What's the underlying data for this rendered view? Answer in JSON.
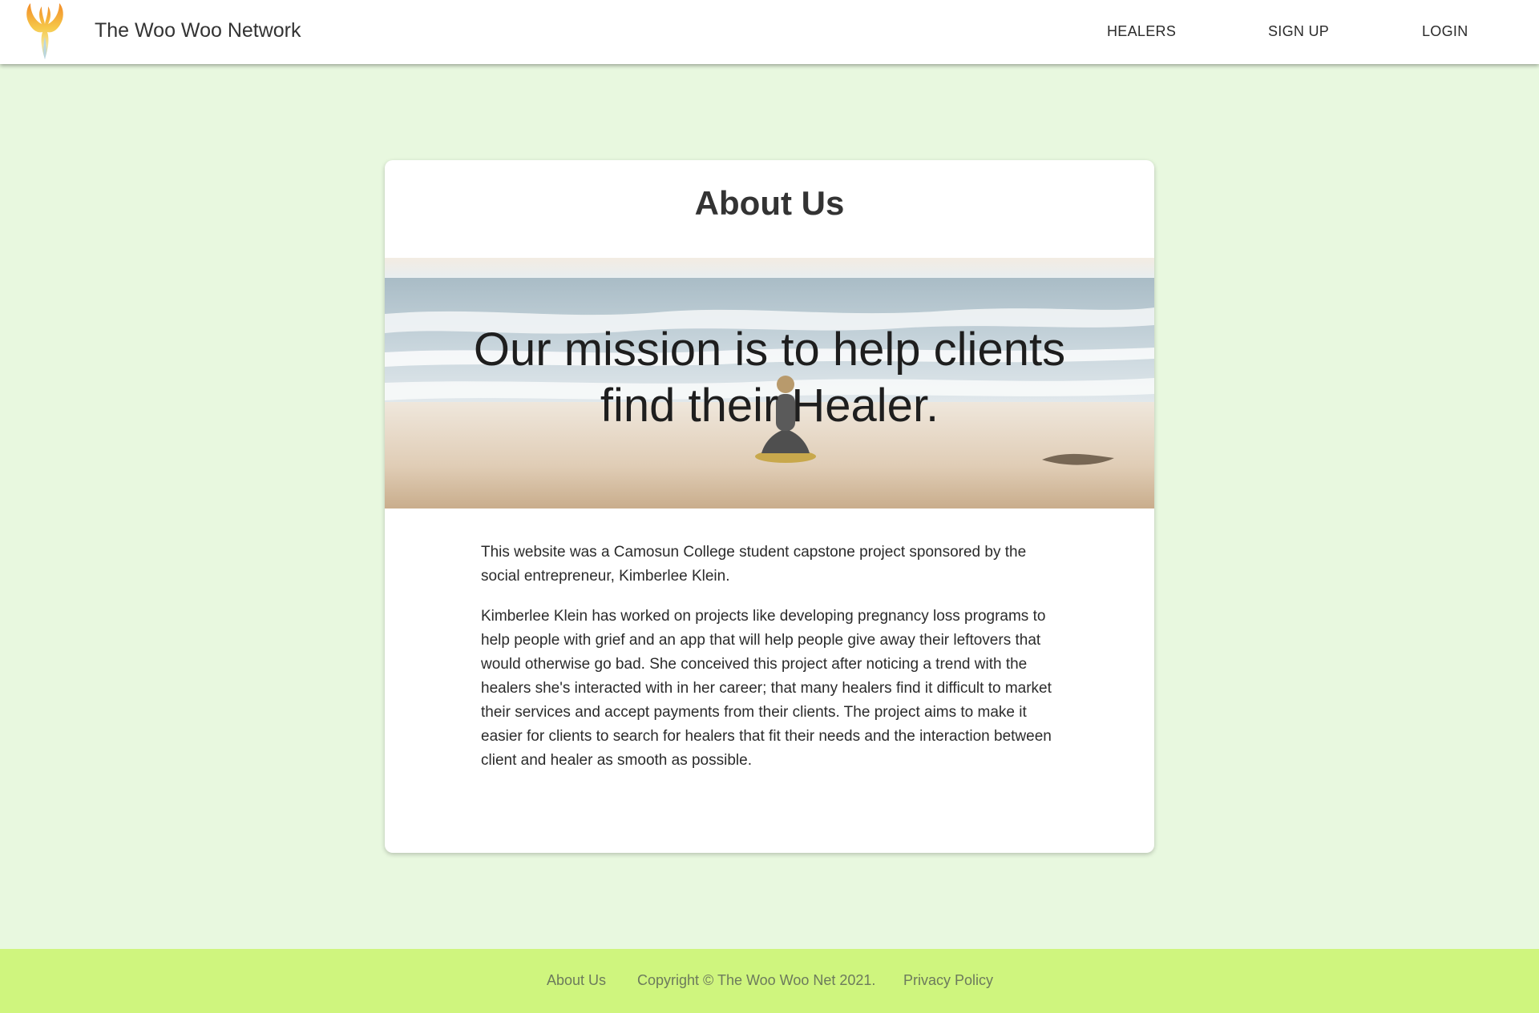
{
  "header": {
    "brand": "The Woo Woo Network",
    "nav": [
      {
        "label": "HEALERS"
      },
      {
        "label": "SIGN UP"
      },
      {
        "label": "LOGIN"
      }
    ]
  },
  "main": {
    "title": "About Us",
    "hero_text": "Our mission is to help clients find their Healer.",
    "paragraphs": [
      "This website was a Camosun College student capstone project sponsored by the social entrepreneur, Kimberlee Klein.",
      "Kimberlee Klein has worked on projects like developing pregnancy loss programs to help people with grief and an app that will help people give away their leftovers that would otherwise go bad. She conceived this project after noticing a trend with the healers she's interacted with in her career; that many healers find it difficult to market their services and accept payments from their clients. The project aims to make it easier for clients to search for healers that fit their needs and the interaction between client and healer as smooth as possible."
    ]
  },
  "footer": {
    "about_link": "About Us",
    "copyright": "Copyright © The Woo Woo Net 2021.",
    "privacy_link": "Privacy Policy"
  },
  "colors": {
    "page_background": "#e8f8df",
    "footer_background": "#cff57e",
    "card_background": "#ffffff"
  },
  "icons": {
    "logo": "phoenix-logo-icon"
  }
}
